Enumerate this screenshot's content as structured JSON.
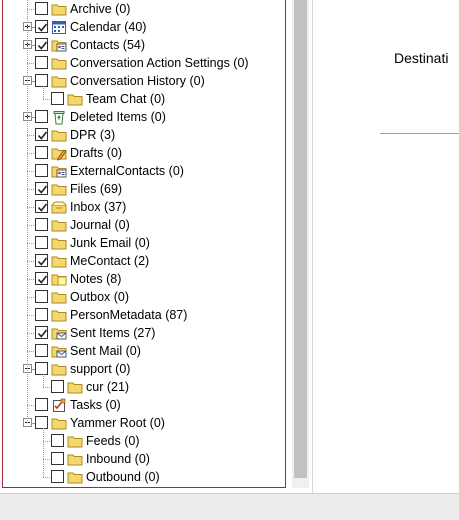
{
  "folder_tree": {
    "items": [
      {
        "label": "Archive (0)",
        "icon": "folder-icon",
        "checked": false,
        "expander": null,
        "indent": 0
      },
      {
        "label": "Calendar (40)",
        "icon": "calendar-icon",
        "checked": true,
        "expander": "plus",
        "indent": 0
      },
      {
        "label": "Contacts (54)",
        "icon": "contacts-icon",
        "checked": true,
        "expander": "plus",
        "indent": 0
      },
      {
        "label": "Conversation Action Settings (0)",
        "icon": "folder-icon",
        "checked": false,
        "expander": null,
        "indent": 0
      },
      {
        "label": "Conversation History (0)",
        "icon": "folder-icon",
        "checked": false,
        "expander": "minus",
        "indent": 0
      },
      {
        "label": "Team Chat (0)",
        "icon": "folder-icon",
        "checked": false,
        "expander": null,
        "indent": 1
      },
      {
        "label": "Deleted Items (0)",
        "icon": "recycle-bin-icon",
        "checked": false,
        "expander": "plus",
        "indent": 0
      },
      {
        "label": "DPR (3)",
        "icon": "folder-icon",
        "checked": true,
        "expander": null,
        "indent": 0
      },
      {
        "label": "Drafts (0)",
        "icon": "drafts-icon",
        "checked": false,
        "expander": null,
        "indent": 0
      },
      {
        "label": "ExternalContacts (0)",
        "icon": "contacts-icon",
        "checked": false,
        "expander": null,
        "indent": 0
      },
      {
        "label": "Files (69)",
        "icon": "folder-icon",
        "checked": true,
        "expander": null,
        "indent": 0
      },
      {
        "label": "Inbox (37)",
        "icon": "inbox-icon",
        "checked": true,
        "expander": null,
        "indent": 0
      },
      {
        "label": "Journal (0)",
        "icon": "folder-icon",
        "checked": false,
        "expander": null,
        "indent": 0
      },
      {
        "label": "Junk Email (0)",
        "icon": "folder-icon",
        "checked": false,
        "expander": null,
        "indent": 0
      },
      {
        "label": "MeContact (2)",
        "icon": "folder-icon",
        "checked": true,
        "expander": null,
        "indent": 0
      },
      {
        "label": "Notes (8)",
        "icon": "notes-icon",
        "checked": true,
        "expander": null,
        "indent": 0
      },
      {
        "label": "Outbox (0)",
        "icon": "folder-icon",
        "checked": false,
        "expander": null,
        "indent": 0
      },
      {
        "label": "PersonMetadata (87)",
        "icon": "folder-icon",
        "checked": false,
        "expander": null,
        "indent": 0
      },
      {
        "label": "Sent Items (27)",
        "icon": "sent-items-icon",
        "checked": true,
        "expander": null,
        "indent": 0
      },
      {
        "label": "Sent Mail (0)",
        "icon": "sent-items-icon",
        "checked": false,
        "expander": null,
        "indent": 0
      },
      {
        "label": "support (0)",
        "icon": "folder-icon",
        "checked": false,
        "expander": "minus",
        "indent": 0
      },
      {
        "label": "cur (21)",
        "icon": "folder-icon",
        "checked": false,
        "expander": null,
        "indent": 1
      },
      {
        "label": "Tasks (0)",
        "icon": "tasks-icon",
        "checked": false,
        "expander": null,
        "indent": 0
      },
      {
        "label": "Yammer Root (0)",
        "icon": "folder-icon",
        "checked": false,
        "expander": "minus",
        "indent": 0
      },
      {
        "label": "Feeds (0)",
        "icon": "folder-icon",
        "checked": false,
        "expander": null,
        "indent": 1
      },
      {
        "label": "Inbound (0)",
        "icon": "folder-icon",
        "checked": false,
        "expander": null,
        "indent": 1
      },
      {
        "label": "Outbound (0)",
        "icon": "folder-icon",
        "checked": false,
        "expander": null,
        "indent": 1
      }
    ]
  },
  "right_pane": {
    "destination_label": "Destinati"
  },
  "colors": {
    "panel_border": "#a5263a",
    "folder_fill": "#f5d76e",
    "check_color": "#222222"
  }
}
